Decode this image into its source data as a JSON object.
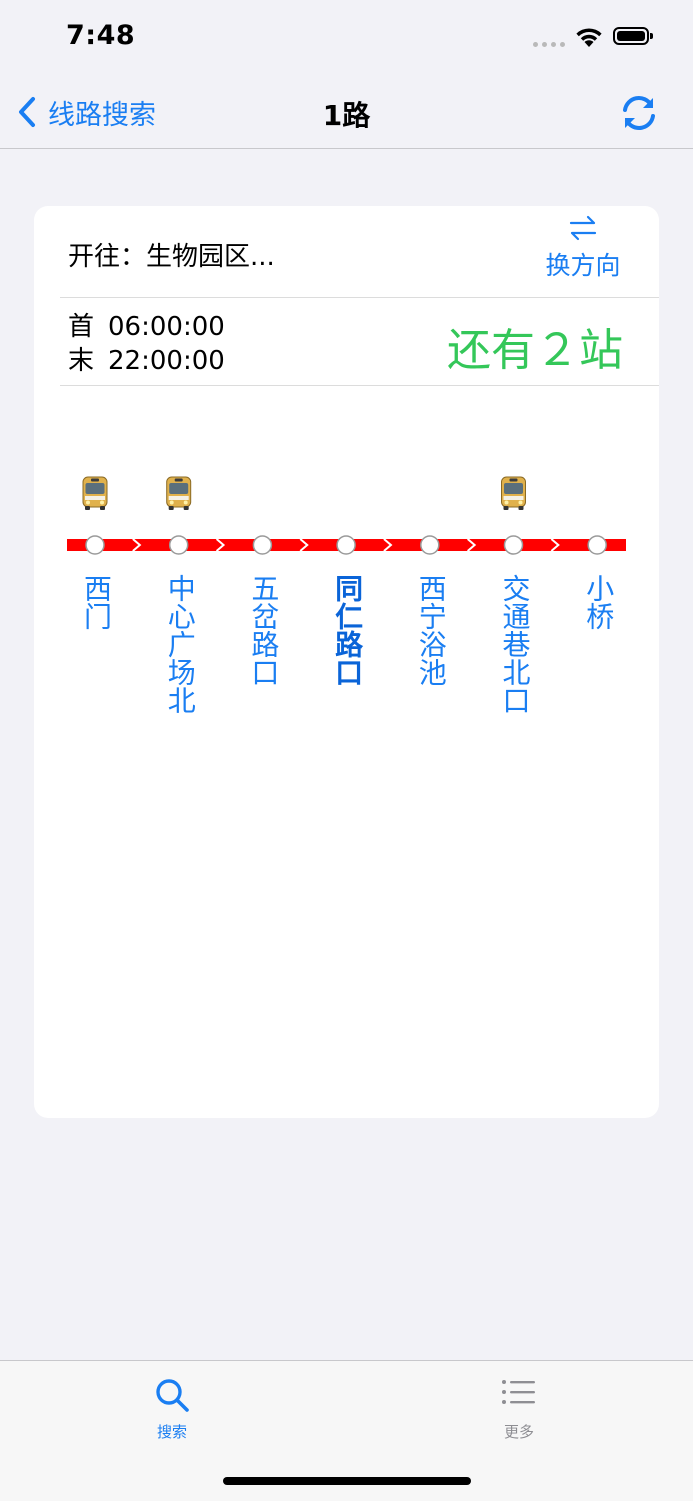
{
  "status_bar": {
    "time": "7:48"
  },
  "nav": {
    "back_label": "线路搜索",
    "title": "1路"
  },
  "card": {
    "destination": "开往：生物园区...",
    "swap_label": "换方向",
    "first_label": "首",
    "first_time": "06:00:00",
    "last_label": "末",
    "last_time": "22:00:00",
    "remaining": "还有２站"
  },
  "route": {
    "stations": [
      {
        "name": "西门",
        "bus": true,
        "current": false
      },
      {
        "name": "中心广场北",
        "bus": true,
        "current": false
      },
      {
        "name": "五岔路口",
        "bus": false,
        "current": false
      },
      {
        "name": "同仁路口",
        "bus": false,
        "current": true
      },
      {
        "name": "西宁浴池",
        "bus": false,
        "current": false
      },
      {
        "name": "交通巷北口",
        "bus": true,
        "current": false
      },
      {
        "name": "小桥",
        "bus": false,
        "current": false
      }
    ],
    "line_color": "#ff0000"
  },
  "tabs": [
    {
      "label": "搜索",
      "active": true
    },
    {
      "label": "更多",
      "active": false
    }
  ],
  "colors": {
    "accent": "#1a7ef2",
    "remaining": "#34c759"
  }
}
